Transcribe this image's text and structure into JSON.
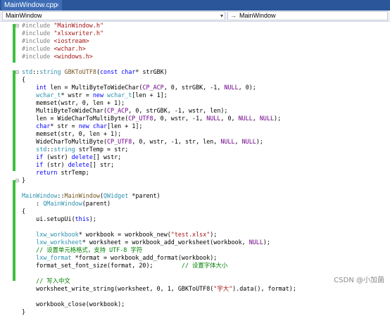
{
  "tab": {
    "title": "MainWindow.cpp",
    "close_glyph": "×"
  },
  "navbar": {
    "class_value": "MainWindow",
    "member_value": "MainWindow",
    "dropdown_glyph": "▾",
    "member_icon": "→"
  },
  "code": {
    "lines": [
      [
        [
          "pp",
          "#include "
        ],
        [
          "str",
          "\"MainWindow.h\""
        ]
      ],
      [
        [
          "pp",
          "#include "
        ],
        [
          "str",
          "\"xlsxwriter.h\""
        ]
      ],
      [
        [
          "pp",
          "#include "
        ],
        [
          "str",
          "<iostream>"
        ]
      ],
      [
        [
          "pp",
          "#include "
        ],
        [
          "str",
          "<wchar.h>"
        ]
      ],
      [
        [
          "pp",
          "#include "
        ],
        [
          "str",
          "<windows.h>"
        ]
      ],
      [],
      [
        [
          "ty",
          "std"
        ],
        [
          "",
          "::"
        ],
        [
          "ty",
          "string"
        ],
        [
          "",
          " "
        ],
        [
          "fn",
          "GBKToUTF8"
        ],
        [
          "",
          "("
        ],
        [
          "kw",
          "const"
        ],
        [
          "",
          " "
        ],
        [
          "kw",
          "char"
        ],
        [
          "",
          "* "
        ],
        [
          "",
          "strGBK)"
        ]
      ],
      [
        [
          "",
          "{"
        ]
      ],
      [
        [
          "",
          "    "
        ],
        [
          "kw",
          "int"
        ],
        [
          "",
          " len = MultiByteToWideChar("
        ],
        [
          "mac",
          "CP_ACP"
        ],
        [
          "",
          ", 0, strGBK, -1, "
        ],
        [
          "mac",
          "NULL"
        ],
        [
          "",
          ", 0);"
        ]
      ],
      [
        [
          "",
          "    "
        ],
        [
          "ty",
          "wchar_t"
        ],
        [
          "",
          "* wstr = "
        ],
        [
          "kw",
          "new"
        ],
        [
          "",
          " "
        ],
        [
          "ty",
          "wchar_t"
        ],
        [
          "",
          "[len + 1];"
        ]
      ],
      [
        [
          "",
          "    memset(wstr, 0, len + 1);"
        ]
      ],
      [
        [
          "",
          "    MultiByteToWideChar("
        ],
        [
          "mac",
          "CP_ACP"
        ],
        [
          "",
          ", 0, strGBK, -1, wstr, len);"
        ]
      ],
      [
        [
          "",
          "    len = WideCharToMultiByte("
        ],
        [
          "mac",
          "CP_UTF8"
        ],
        [
          "",
          ", 0, wstr, -1, "
        ],
        [
          "mac",
          "NULL"
        ],
        [
          "",
          ", 0, "
        ],
        [
          "mac",
          "NULL"
        ],
        [
          "",
          ", "
        ],
        [
          "mac",
          "NULL"
        ],
        [
          "",
          ");"
        ]
      ],
      [
        [
          "",
          "    "
        ],
        [
          "kw",
          "char"
        ],
        [
          "",
          "* str = "
        ],
        [
          "kw",
          "new"
        ],
        [
          "",
          " "
        ],
        [
          "kw",
          "char"
        ],
        [
          "",
          "[len + 1];"
        ]
      ],
      [
        [
          "",
          "    memset(str, 0, len + 1);"
        ]
      ],
      [
        [
          "",
          "    WideCharToMultiByte("
        ],
        [
          "mac",
          "CP_UTF8"
        ],
        [
          "",
          ", 0, wstr, -1, str, len, "
        ],
        [
          "mac",
          "NULL"
        ],
        [
          "",
          ", "
        ],
        [
          "mac",
          "NULL"
        ],
        [
          "",
          ");"
        ]
      ],
      [
        [
          "",
          "    "
        ],
        [
          "ty",
          "std"
        ],
        [
          "",
          "::"
        ],
        [
          "ty",
          "string"
        ],
        [
          "",
          " strTemp = str;"
        ]
      ],
      [
        [
          "",
          "    "
        ],
        [
          "kw",
          "if"
        ],
        [
          "",
          " (wstr) "
        ],
        [
          "kw",
          "delete"
        ],
        [
          "",
          "[] wstr;"
        ]
      ],
      [
        [
          "",
          "    "
        ],
        [
          "kw",
          "if"
        ],
        [
          "",
          " (str) "
        ],
        [
          "kw",
          "delete"
        ],
        [
          "",
          "[] str;"
        ]
      ],
      [
        [
          "",
          "    "
        ],
        [
          "kw",
          "return"
        ],
        [
          "",
          " strTemp;"
        ]
      ],
      [
        [
          "",
          "}"
        ]
      ],
      [],
      [
        [
          "ty",
          "MainWindow"
        ],
        [
          "",
          "::"
        ],
        [
          "fn",
          "MainWindow"
        ],
        [
          "",
          "("
        ],
        [
          "ty",
          "QWidget"
        ],
        [
          "",
          " *parent)"
        ]
      ],
      [
        [
          "",
          "    : "
        ],
        [
          "ty",
          "QMainWindow"
        ],
        [
          "",
          "(parent)"
        ]
      ],
      [
        [
          "",
          "{"
        ]
      ],
      [
        [
          "",
          "    ui.setupUi("
        ],
        [
          "kw",
          "this"
        ],
        [
          "",
          ");"
        ]
      ],
      [],
      [
        [
          "",
          "    "
        ],
        [
          "ty",
          "lxw_workbook"
        ],
        [
          "",
          "* workbook = workbook_new("
        ],
        [
          "str",
          "\"test.xlsx\""
        ],
        [
          "",
          ");"
        ]
      ],
      [
        [
          "",
          "    "
        ],
        [
          "ty",
          "lxw_worksheet"
        ],
        [
          "",
          "* worksheet = workbook_add_worksheet(workbook, "
        ],
        [
          "mac",
          "NULL"
        ],
        [
          "",
          ");"
        ]
      ],
      [
        [
          "",
          "    "
        ],
        [
          "cm",
          "// 设置单元格格式，支持 UTF-8 字符"
        ]
      ],
      [
        [
          "",
          "    "
        ],
        [
          "ty",
          "lxw_format"
        ],
        [
          "",
          " *format = workbook_add_format(workbook);"
        ]
      ],
      [
        [
          "",
          "    format_set_font_size(format, 20);        "
        ],
        [
          "cm",
          "// 设置字体大小"
        ]
      ],
      [],
      [
        [
          "",
          "    "
        ],
        [
          "cm",
          "// 写入中文"
        ]
      ],
      [
        [
          "",
          "    worksheet_write_string(worksheet, 0, 1, GBKToUTF8("
        ],
        [
          "str",
          "\"宇大\""
        ],
        [
          "",
          ").data(), format);"
        ]
      ],
      [],
      [
        [
          "",
          "    workbook_close(workbook);"
        ]
      ],
      [
        [
          "",
          "}"
        ]
      ]
    ]
  },
  "fold_glyph": "⊟",
  "colors": {
    "tab_bar": "#2b579a",
    "change_margin": "#3fbf3f",
    "keyword": "#0000ff",
    "type": "#2b91af",
    "string": "#a31515",
    "comment": "#008000",
    "macro": "#6f008a",
    "preprocessor": "#808080"
  },
  "watermark": "CSDN @小加菌"
}
